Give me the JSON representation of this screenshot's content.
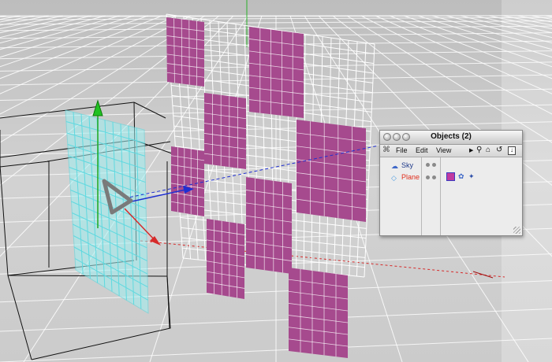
{
  "objects_panel": {
    "title": "Objects (2)",
    "menu": {
      "file": "File",
      "edit": "Edit",
      "view": "View"
    },
    "toolbar_icons": [
      "play-arrow-icon",
      "search-icon",
      "home-icon",
      "refresh-icon",
      "pin-icon"
    ],
    "objects": [
      {
        "name": "Sky",
        "icon": "sky-icon",
        "name_color": "#1f3a8a"
      },
      {
        "name": "Plane",
        "icon": "plane-icon",
        "name_color": "#e0301e"
      }
    ]
  },
  "colors": {
    "viewport_bg": "#cfcfcf",
    "floor_grid": "#ffffff",
    "magenta_tile": "#a64a8e",
    "selected_plane": "#8ee8ee",
    "axis_x": "#d62a2a",
    "axis_y": "#1ea81e",
    "axis_z": "#1f2fd1"
  }
}
